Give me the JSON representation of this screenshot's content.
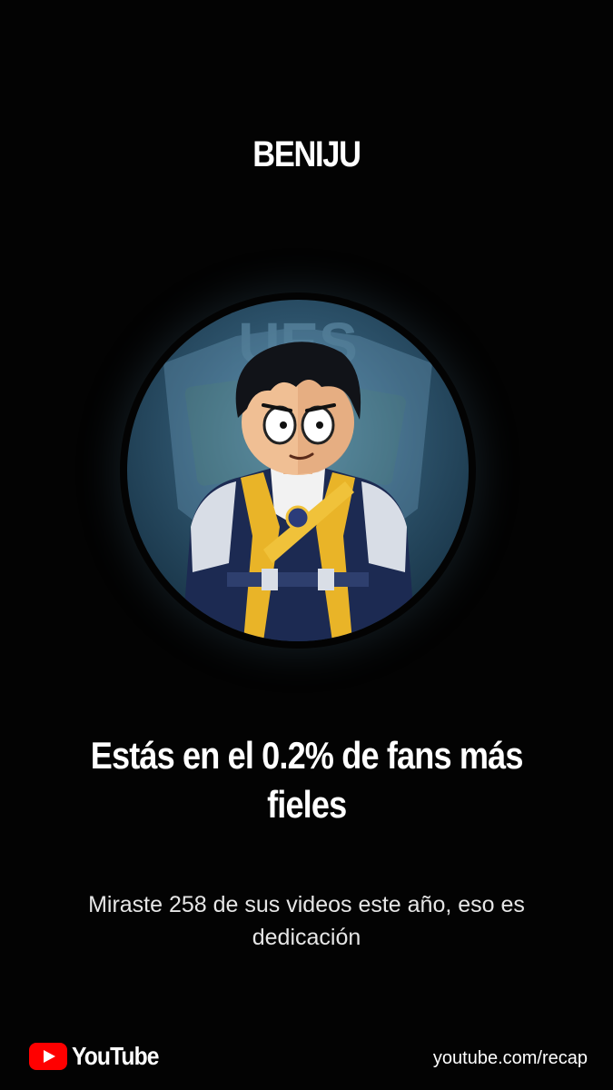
{
  "channel": {
    "name": "BENIJU"
  },
  "avatar": {
    "icon": "channel-avatar-anime-boy"
  },
  "stat": {
    "headline_line1": "Estás en el 0.2% de fans más",
    "headline_line2": "fieles",
    "subtext_line1": "Miraste 258 de sus videos este año, eso es",
    "subtext_line2": "dedicación",
    "top_fan_percent": 0.2,
    "videos_watched": 258
  },
  "footer": {
    "brand": "YouTube",
    "url": "youtube.com/recap",
    "brand_color": "#FF0000"
  },
  "colors": {
    "background": "#030303",
    "text": "#FFFFFF"
  }
}
